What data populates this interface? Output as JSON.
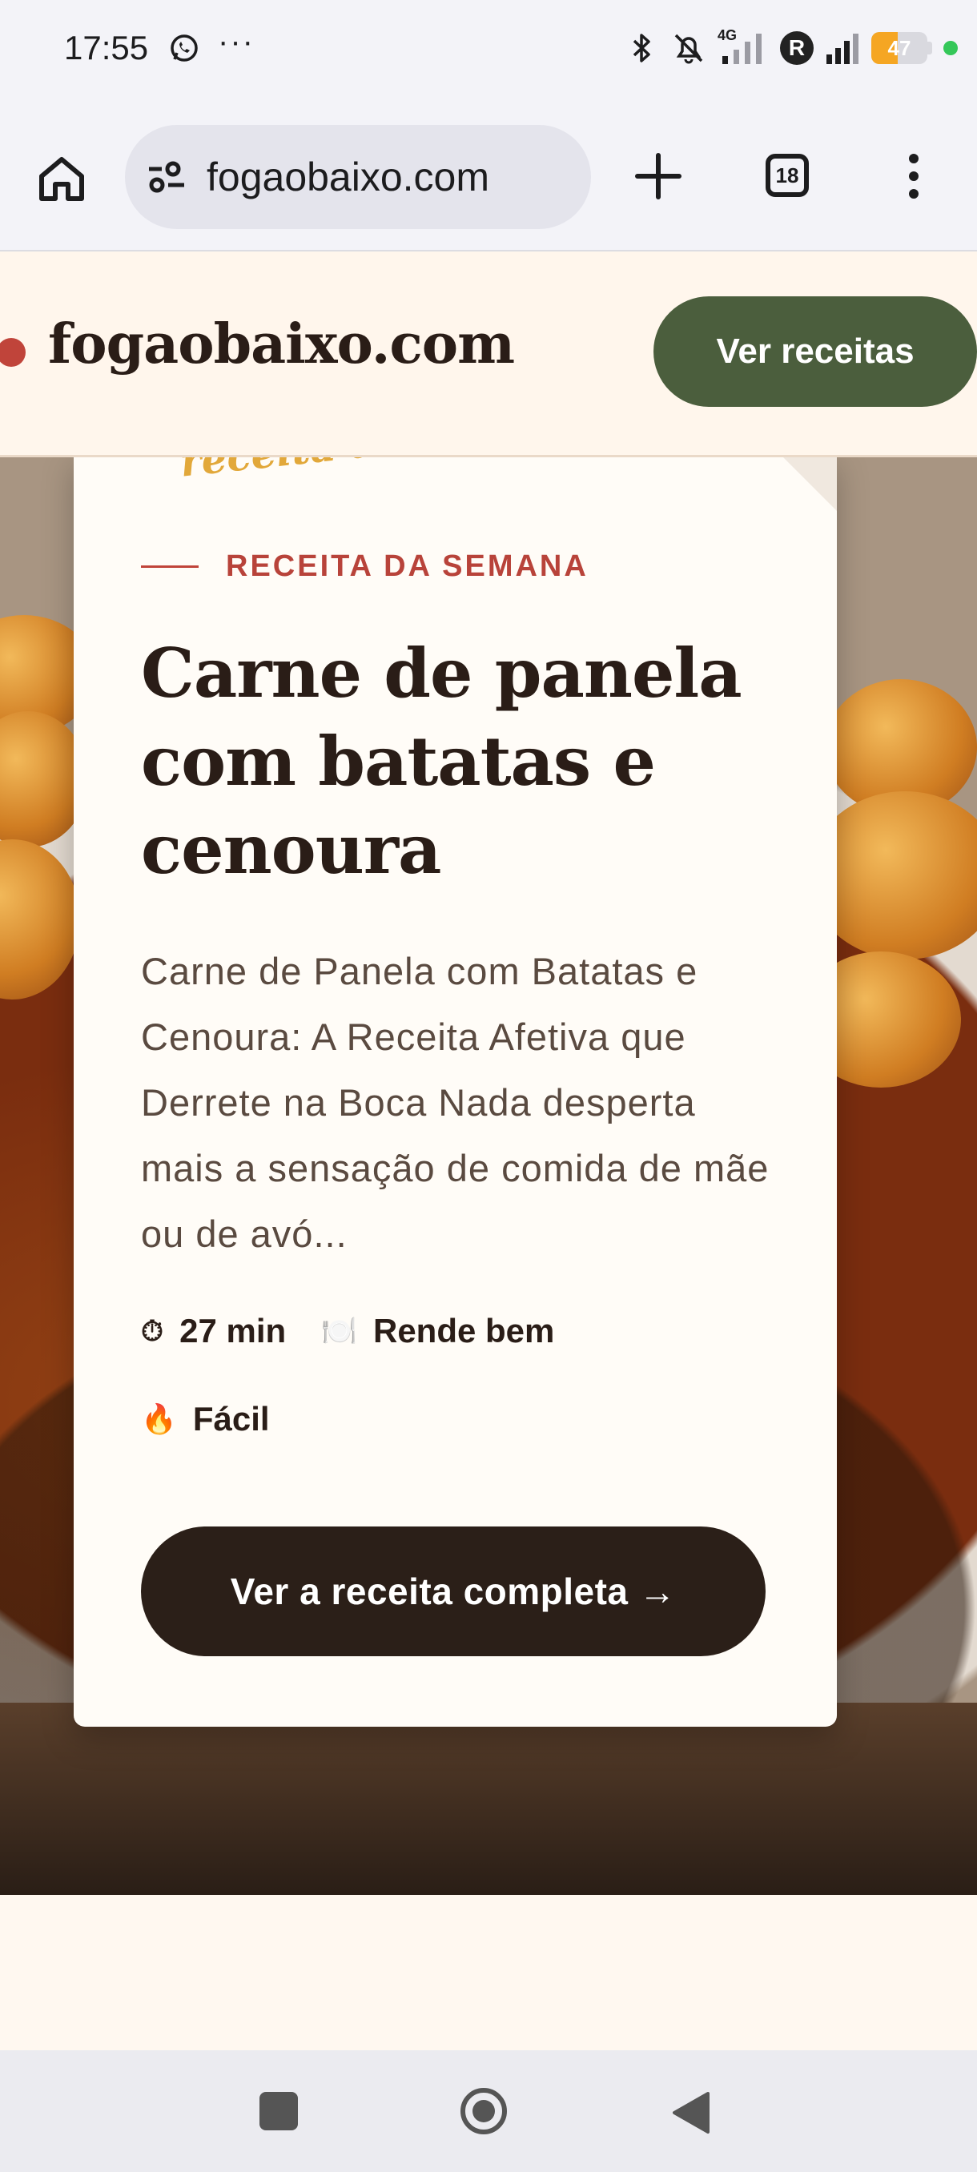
{
  "status_bar": {
    "time": "17:55",
    "more": "···",
    "network_label": "4G",
    "profile_badge": "R",
    "battery": "47",
    "battery_level": 0.47,
    "icons": [
      "whatsapp-icon",
      "bluetooth-icon",
      "mute-icon",
      "signal-icon",
      "battery-icon"
    ]
  },
  "browser": {
    "url": "fogaobaixo.com",
    "tab_count": "18"
  },
  "site": {
    "brand": "fogaobaixo.com",
    "cta_label": "Ver receitas"
  },
  "card": {
    "handwritten_note": "receita de hoje",
    "eyebrow": "RECEITA DA SEMANA",
    "title": "Carne de panela com batatas e cenoura",
    "description": "Carne de Panela com Batatas e Cenoura: A Receita Afetiva que Derrete na Boca Nada desperta mais a sensação de comida de mãe ou de avó...",
    "meta": {
      "time_icon": "⏱",
      "time": "27 min",
      "yield_icon": "🍽️",
      "yield": "Rende bem",
      "difficulty_icon": "🔥",
      "difficulty": "Fácil"
    },
    "button_label": "Ver a receita completa →"
  },
  "colors": {
    "accent_green": "#4b5e3d",
    "accent_red": "#c0443a",
    "dark": "#2b1f18",
    "page_bg": "#fff8f0"
  }
}
